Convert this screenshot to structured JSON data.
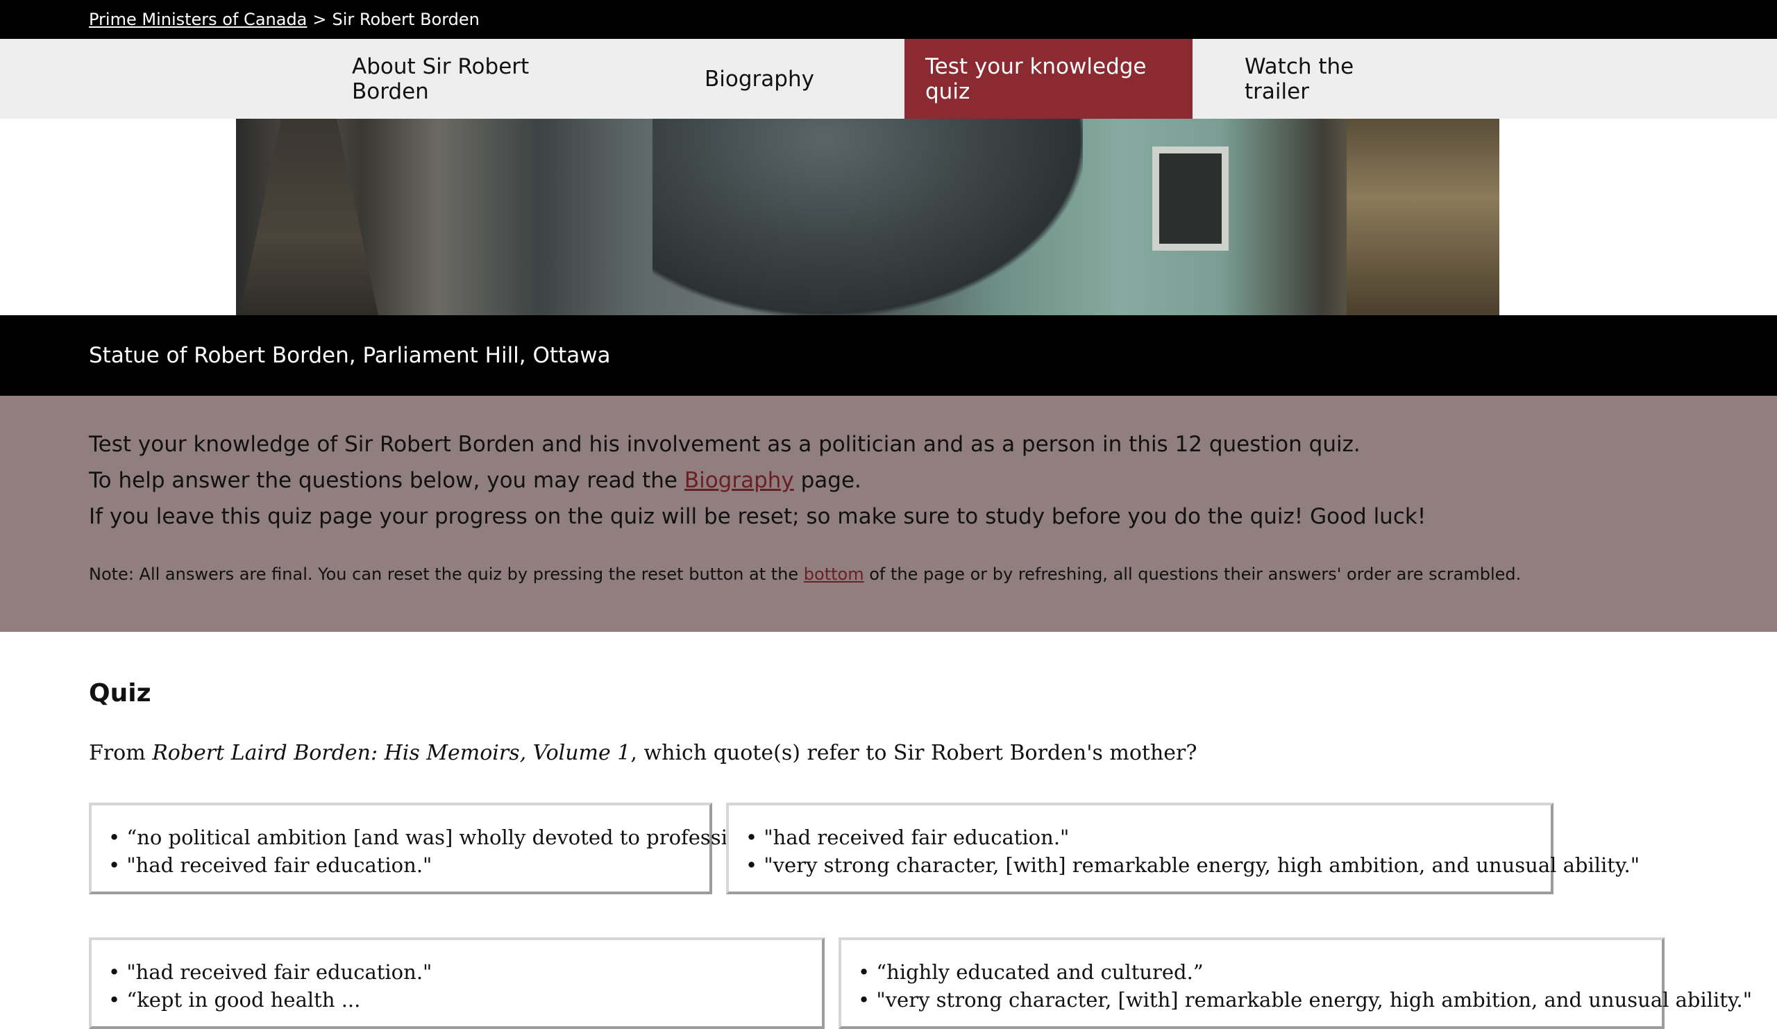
{
  "breadcrumb": {
    "parent": "Prime Ministers of Canada",
    "separator": ">",
    "current": "Sir Robert Borden"
  },
  "nav": {
    "items": [
      {
        "label": "About Sir Robert Borden"
      },
      {
        "label": "Biography"
      },
      {
        "label": "Test your knowledge quiz"
      },
      {
        "label": "Watch the trailer"
      }
    ],
    "active_index": 2
  },
  "caption": "Statue of Robert Borden, Parliament Hill, Ottawa",
  "intro": {
    "line1": "Test your knowledge of Sir Robert Borden and his involvement as a politician and as a person in this 12 question quiz.",
    "line2_before": "To help answer the questions below, you may read the ",
    "line2_link": "Biography",
    "line2_after": " page.",
    "line3": "If you leave this quiz page your progress on the quiz will be reset; so make sure to study before you do the quiz! Good luck!",
    "note_before": "Note: All answers are final. You can reset the quiz by pressing the reset button at the ",
    "note_link": "bottom",
    "note_after": " of the page or by refreshing, all questions their answers' order are scrambled."
  },
  "quiz": {
    "heading": "Quiz",
    "question_prefix": "From ",
    "question_source": "Robert Laird Borden: His Memoirs, Volume 1",
    "question_suffix": ", which quote(s) refer to Sir Robert Borden's mother?",
    "answers": [
      {
        "lines": [
          "• “no political ambition [and was] wholly devoted to profession.”",
          "• \"had received fair education.\""
        ]
      },
      {
        "lines": [
          "• \"had received fair education.\"",
          "• \"very strong character, [with] remarkable energy, high ambition, and unusual ability.\""
        ]
      },
      {
        "lines": [
          "• \"had received fair education.\"",
          "• “kept in good health ..."
        ]
      },
      {
        "lines": [
          "• “highly educated and cultured.”",
          "• \"very strong character, [with] remarkable energy, high ambition, and unusual ability.\""
        ]
      }
    ]
  },
  "colors": {
    "accent": "#8b2a31",
    "intro_bg": "#917f80",
    "nav_bg": "#eeeeee"
  }
}
